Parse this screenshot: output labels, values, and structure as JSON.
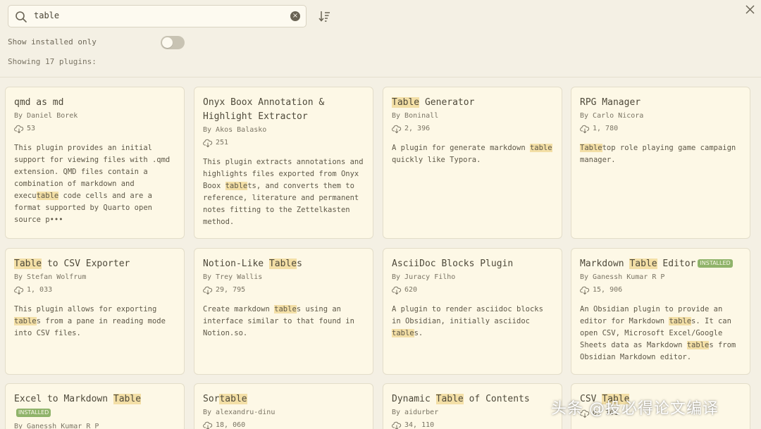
{
  "search": {
    "value": "table"
  },
  "filter": {
    "show_installed_label": "Show installed only",
    "show_installed_on": false
  },
  "result_count": "Showing 17 plugins:",
  "plugins": [
    {
      "name_parts": [
        "qmd as md"
      ],
      "name_hl": [
        false
      ],
      "author": "By Daniel Borek",
      "downloads": "53",
      "desc_parts": [
        "This plugin provides an initial support for viewing files with .qmd extension. QMD files contain a combination of markdown and execu",
        "table",
        " code cells and are a format supported by Quarto open source p•••"
      ],
      "desc_hl": [
        false,
        true,
        false
      ],
      "installed": false
    },
    {
      "name_parts": [
        "Onyx Boox Annotation & Highlight Extractor"
      ],
      "name_hl": [
        false
      ],
      "author": "By Akos Balasko",
      "downloads": "251",
      "desc_parts": [
        "This plugin extracts annotations and highlights files exported from Onyx Boox ",
        "table",
        "ts, and converts them to reference, literature and permanent notes fitting to the Zettelkasten method."
      ],
      "desc_hl": [
        false,
        true,
        false
      ],
      "installed": false
    },
    {
      "name_parts": [
        "Table",
        " Generator"
      ],
      "name_hl": [
        true,
        false
      ],
      "author": "By Boninall",
      "downloads": "2, 396",
      "desc_parts": [
        "A plugin for generate markdown ",
        "table",
        " quickly like Typora."
      ],
      "desc_hl": [
        false,
        true,
        false
      ],
      "installed": false
    },
    {
      "name_parts": [
        "RPG Manager"
      ],
      "name_hl": [
        false
      ],
      "author": "By Carlo Nicora",
      "downloads": "1, 780",
      "desc_parts": [
        "Table",
        "top role playing game campaign manager."
      ],
      "desc_hl": [
        true,
        false
      ],
      "installed": false
    },
    {
      "name_parts": [
        "Table",
        " to CSV Exporter"
      ],
      "name_hl": [
        true,
        false
      ],
      "author": "By Stefan Wolfrum",
      "downloads": "1, 033",
      "desc_parts": [
        "This plugin allows for exporting ",
        "table",
        "s from a pane in reading mode into CSV files."
      ],
      "desc_hl": [
        false,
        true,
        false
      ],
      "installed": false
    },
    {
      "name_parts": [
        "Notion-Like ",
        "Table",
        "s"
      ],
      "name_hl": [
        false,
        true,
        false
      ],
      "author": "By Trey Wallis",
      "downloads": "29, 795",
      "desc_parts": [
        "Create markdown ",
        "table",
        "s using an interface similar to that found in Notion.so."
      ],
      "desc_hl": [
        false,
        true,
        false
      ],
      "installed": false
    },
    {
      "name_parts": [
        "AsciiDoc Blocks Plugin"
      ],
      "name_hl": [
        false
      ],
      "author": "By Juracy Filho",
      "downloads": "620",
      "desc_parts": [
        "A plugin to render asciidoc blocks in Obsidian, initially asciidoc ",
        "table",
        "s."
      ],
      "desc_hl": [
        false,
        true,
        false
      ],
      "installed": false
    },
    {
      "name_parts": [
        "Markdown ",
        "Table",
        " Editor"
      ],
      "name_hl": [
        false,
        true,
        false
      ],
      "author": "By Ganessh Kumar R P",
      "downloads": "15, 906",
      "desc_parts": [
        "An Obsidian plugin to provide an editor for Markdown ",
        "table",
        "s. It can open CSV, Microsoft Excel/Google Sheets data as Markdown ",
        "table",
        "s from Obsidian Markdown editor."
      ],
      "desc_hl": [
        false,
        true,
        false,
        true,
        false
      ],
      "installed": true
    },
    {
      "name_parts": [
        "Excel to Markdown ",
        "Table"
      ],
      "name_hl": [
        false,
        true
      ],
      "author": "By Ganessh Kumar R P",
      "downloads": "",
      "desc_parts": [],
      "desc_hl": [],
      "installed": true
    },
    {
      "name_parts": [
        "Sor",
        "table"
      ],
      "name_hl": [
        false,
        true
      ],
      "author": "By alexandru-dinu",
      "downloads": "18, 060",
      "desc_parts": [],
      "desc_hl": [],
      "installed": false
    },
    {
      "name_parts": [
        "Dynamic ",
        "Table",
        " of Contents"
      ],
      "name_hl": [
        false,
        true,
        false
      ],
      "author": "By aidurber",
      "downloads": "34, 110",
      "desc_parts": [],
      "desc_hl": [],
      "installed": false
    },
    {
      "name_parts": [
        "CSV ",
        "Table"
      ],
      "name_hl": [
        false,
        true
      ],
      "author": "",
      "downloads": "6, 761",
      "desc_parts": [],
      "desc_hl": [],
      "installed": false
    }
  ],
  "installed_badge": "INSTALLED",
  "watermark": "头条 @投必得论文编译",
  "colors": {
    "background": "#f4f0e4",
    "card": "#fdf8e6",
    "highlight": "#f3dfa6",
    "badge": "#8fb36a"
  },
  "icons": {
    "search": "search-icon",
    "clear": "clear-icon",
    "sort": "sort-icon",
    "close": "close-icon",
    "download": "download-icon"
  }
}
